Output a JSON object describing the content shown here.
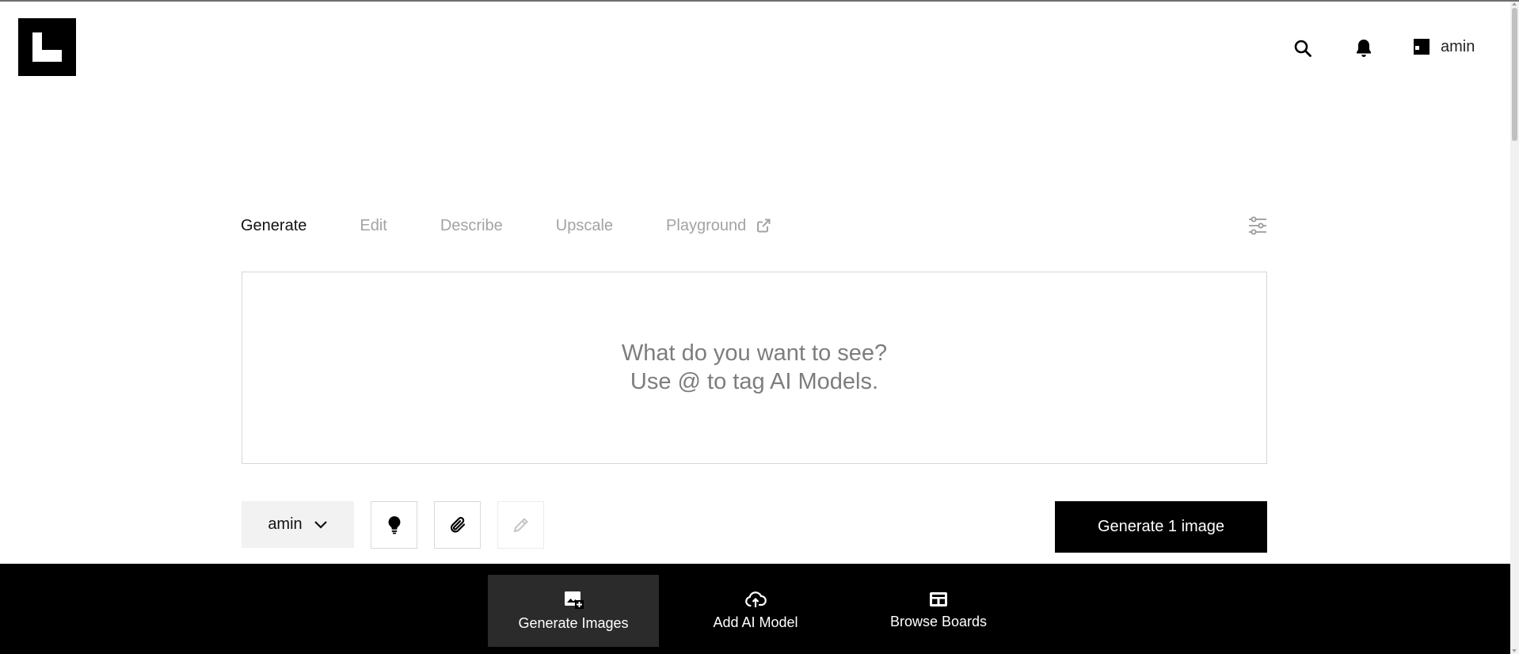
{
  "header": {
    "user_name": "amin",
    "icons": [
      "search-icon",
      "bell-icon",
      "user-icon"
    ]
  },
  "tabs": [
    {
      "label": "Generate",
      "active": true
    },
    {
      "label": "Edit",
      "active": false
    },
    {
      "label": "Describe",
      "active": false
    },
    {
      "label": "Upscale",
      "active": false
    },
    {
      "label": "Playground",
      "active": false,
      "icon": "external-link-icon"
    }
  ],
  "prompt": {
    "placeholder": "What do you want to see?\nUse @ to tag AI Models.",
    "value": ""
  },
  "controls": {
    "model_label": "amin",
    "tools": [
      "lightbulb-icon",
      "paperclip-icon",
      "pencil-icon"
    ],
    "generate_label": "Generate 1 image"
  },
  "bottom_nav": {
    "items": [
      {
        "label": "Generate Images",
        "icon": "image-add-icon",
        "active": true
      },
      {
        "label": "Add AI Model",
        "icon": "cloud-upload-icon",
        "active": false
      },
      {
        "label": "Browse Boards",
        "icon": "grid-icon",
        "active": false
      }
    ]
  },
  "colors": {
    "primary": "#000000",
    "inactive_tab": "#a3a3a3",
    "active_bottom_item": "#2b2b2b"
  }
}
